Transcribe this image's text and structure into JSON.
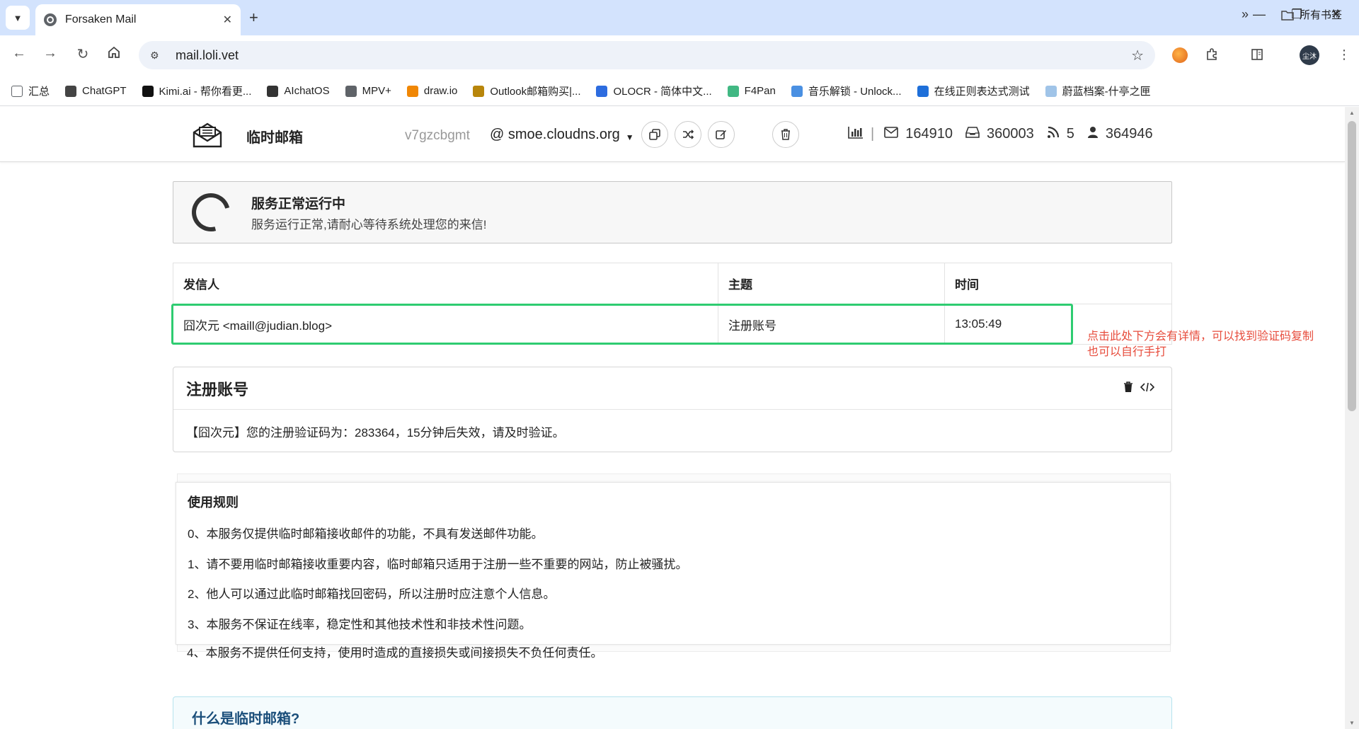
{
  "browser": {
    "tab_title": "Forsaken Mail",
    "url": "mail.loli.vet",
    "avatar_text": "尘沐",
    "bookmarks": [
      {
        "label": "汇总",
        "icon": "folder-icon",
        "color": "#5f6368"
      },
      {
        "label": "ChatGPT",
        "icon": "chatgpt-icon",
        "color": "#444444"
      },
      {
        "label": "Kimi.ai - 帮你看更...",
        "icon": "kimi-icon",
        "color": "#111111"
      },
      {
        "label": "AIchatOS",
        "icon": "openai-icon",
        "color": "#333333"
      },
      {
        "label": "MPV+",
        "icon": "globe-icon",
        "color": "#5f6368"
      },
      {
        "label": "draw.io",
        "icon": "drawio-icon",
        "color": "#f08705"
      },
      {
        "label": "Outlook邮箱购买|...",
        "icon": "outlook-icon",
        "color": "#b8860b"
      },
      {
        "label": "OLOCR - 简体中文...",
        "icon": "ocr-icon",
        "color": "#2d6cdf"
      },
      {
        "label": "F4Pan",
        "icon": "vue-icon",
        "color": "#41b883"
      },
      {
        "label": "音乐解锁 - Unlock...",
        "icon": "music-icon",
        "color": "#4a90e2"
      },
      {
        "label": "在线正则表达式测试",
        "icon": "regex-icon",
        "color": "#1e6fd9"
      },
      {
        "label": "蔚蓝档案-什亭之匣",
        "icon": "bluearchive-icon",
        "color": "#a0c4e8"
      }
    ],
    "all_bookmarks": "所有书签"
  },
  "header": {
    "site_title": "临时邮箱",
    "mail_user": "v7gzcbgmt",
    "mail_domain": "@ smoe.cloudns.org",
    "stats": {
      "emails": "164910",
      "inbox": "360003",
      "online": "5",
      "users": "364946"
    }
  },
  "status": {
    "title": "服务正常运行中",
    "subtitle": "服务运行正常,请耐心等待系统处理您的来信!"
  },
  "table": {
    "headers": [
      "发信人",
      "主题",
      "时间"
    ],
    "rows": [
      {
        "sender": "囧次元 <maill@judian.blog>",
        "subject": "注册账号",
        "time": "13:05:49"
      }
    ]
  },
  "annotation": {
    "line1": "点击此处下方会有详情，可以找到验证码复制",
    "line2": "也可以自行手打"
  },
  "detail": {
    "title": "注册账号",
    "body": "【囧次元】您的注册验证码为：283364，15分钟后失效，请及时验证。"
  },
  "rules": {
    "title": "使用规则",
    "items": [
      "0、本服务仅提供临时邮箱接收邮件的功能，不具有发送邮件功能。",
      "1、请不要用临时邮箱接收重要内容，临时邮箱只适用于注册一些不重要的网站，防止被骚扰。",
      "2、他人可以通过此临时邮箱找回密码，所以注册时应注意个人信息。",
      "3、本服务不保证在线率，稳定性和其他技术性和非技术性问题。",
      "4、本服务不提供任何支持，使用时造成的直接损失或间接损失不负任何责任。"
    ]
  },
  "whatis": {
    "title": "什么是临时邮箱?"
  },
  "colors": {
    "highlight": "#2ecc71",
    "annotation": "#e74c3c",
    "tabstrip": "#d3e3fd"
  }
}
